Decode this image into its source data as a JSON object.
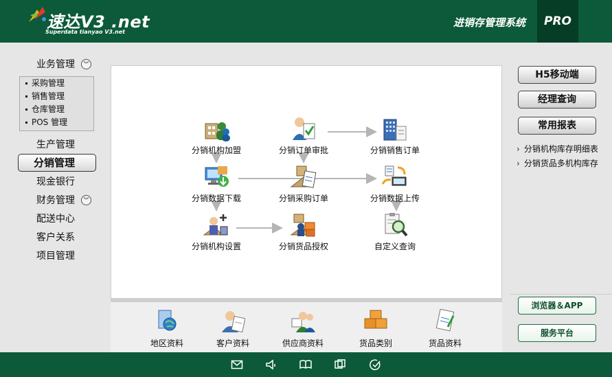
{
  "header": {
    "logo_title": "速达V3 .net",
    "logo_sub": "Superdata tianyao V3.net",
    "system_title": "进销存管理系统",
    "edition": "PRO"
  },
  "nav": {
    "business": "业务管理",
    "sub_items": [
      "采购管理",
      "销售管理",
      "仓库管理",
      "POS 管理"
    ],
    "production": "生产管理",
    "distribution": "分销管理",
    "cash": "现金银行",
    "finance": "财务管理",
    "delivery": "配送中心",
    "crm": "客户关系",
    "project": "项目管理"
  },
  "flow": {
    "org_join": "分销机构加盟",
    "order_approve": "分销订单审批",
    "sales_order": "分销销售订单",
    "data_download": "分销数据下载",
    "purchase_order": "分销采购订单",
    "data_upload": "分销数据上传",
    "org_setup": "分销机构设置",
    "goods_auth": "分销货品授权",
    "custom_query": "自定义查询"
  },
  "bottom": {
    "region": "地区资料",
    "customer": "客户资料",
    "supplier": "供应商资料",
    "goods_type": "货品类别",
    "goods": "货品资料"
  },
  "right": {
    "h5": "H5移动端",
    "manager": "经理查询",
    "reports": "常用报表",
    "link1": "分销机构库存明细表",
    "link2": "分销货品多机构库存",
    "browser": "浏览器＆APP",
    "service": "服务平台"
  },
  "colors": {
    "brand_green": "#0c5a3a",
    "dark_green": "#063d26"
  }
}
